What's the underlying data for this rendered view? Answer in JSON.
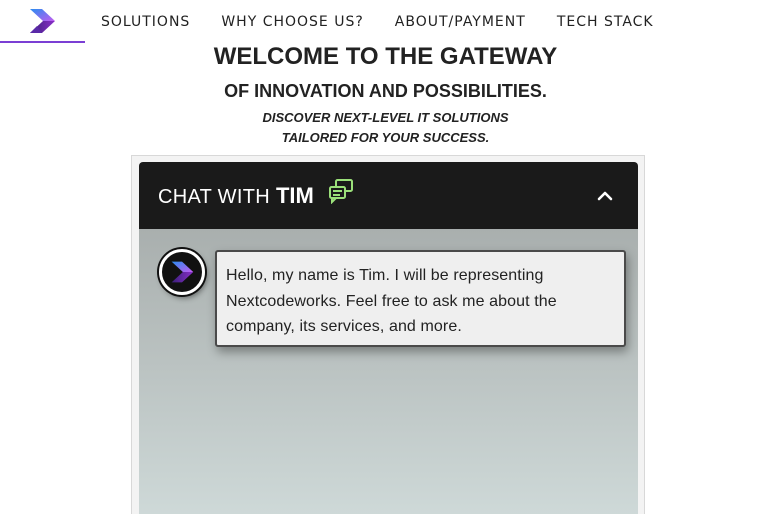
{
  "nav": {
    "logo_icon": "nextcodeworks-logo",
    "links": [
      {
        "label": "SOLUTIONS"
      },
      {
        "label": "WHY CHOOSE US?"
      },
      {
        "label": "ABOUT/PAYMENT"
      },
      {
        "label": "TECH STACK"
      }
    ],
    "active_underline_color": "#7b3fd4"
  },
  "hero": {
    "title": "WELCOME TO THE GATEWAY",
    "subtitle": "OF INNOVATION AND POSSIBILITIES.",
    "tagline_line1": "DISCOVER NEXT-LEVEL IT SOLUTIONS",
    "tagline_line2": "TAILORED FOR YOUR SUCCESS."
  },
  "chat": {
    "title_prefix": "CHAT WITH",
    "bot_name": "TIM",
    "header_icon": "chat-bubbles-icon",
    "collapse_icon": "chevron-up-icon",
    "header_color": "#1a1a1a",
    "messages": [
      {
        "sender": "bot",
        "avatar_icon": "bot-avatar-logo",
        "text": "Hello, my name is Tim. I will be representing Nextcodeworks. Feel free to ask me about the company, its services, and more."
      }
    ]
  }
}
